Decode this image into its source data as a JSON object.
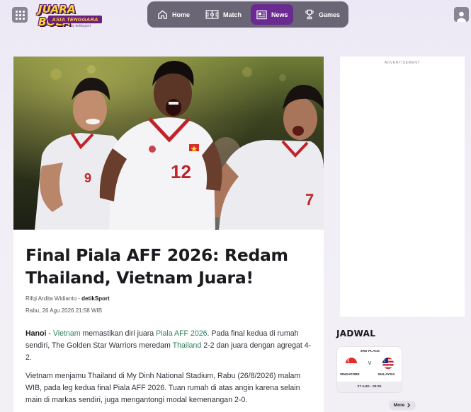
{
  "header": {
    "logo": {
      "line1": "JUARA BOLA",
      "line2": "ASIA TENGGARA",
      "line3": "by detiksport"
    },
    "nav": [
      {
        "label": "Home",
        "icon": "home-icon",
        "active": false
      },
      {
        "label": "Match",
        "icon": "pitch-icon",
        "active": false
      },
      {
        "label": "News",
        "icon": "news-icon",
        "active": true
      },
      {
        "label": "Games",
        "icon": "trophy-icon",
        "active": false
      }
    ],
    "colors": {
      "nav_bg": "#6b6676",
      "nav_active": "#6a2a91"
    }
  },
  "article": {
    "title": "Final Piala AFF 2026: Redam Thailand, Vietnam Juara!",
    "author": "Rifqi Ardita Widianto",
    "byline_separator": " - ",
    "source": "detikSport",
    "date": "Rabu, 26 Agu 2026 21:58 WIB",
    "p1": {
      "place": "Hanoi",
      "dash": " - ",
      "link1": "Vietnam",
      "t1": " memastikan diri juara ",
      "link2": "Piala AFF 2026",
      "t2": ". Pada final kedua di rumah sendiri, The Golden Star Warriors meredam ",
      "link3": "Thailand",
      "t3": " 2-2 dan juara dengan agregat 4-2."
    },
    "p2": "Vietnam menjamu Thailand di My Dinh National Stadium, Rabu (26/8/2026) malam WIB, pada leg kedua final Piala AFF 2026. Tuan rumah di atas angin karena selain main di markas sendiri, juga mengantongi modal kemenangan 2-0."
  },
  "sidebar": {
    "ad_label": "ADVERTISEMENT",
    "schedule_title": "JADWAL",
    "match": {
      "round": "3RD PLACE",
      "home": "SINGAPORE",
      "vs": "V",
      "away": "MALAYSIA",
      "datetime": "27 AUG - 00:25"
    },
    "more_label": "More"
  }
}
